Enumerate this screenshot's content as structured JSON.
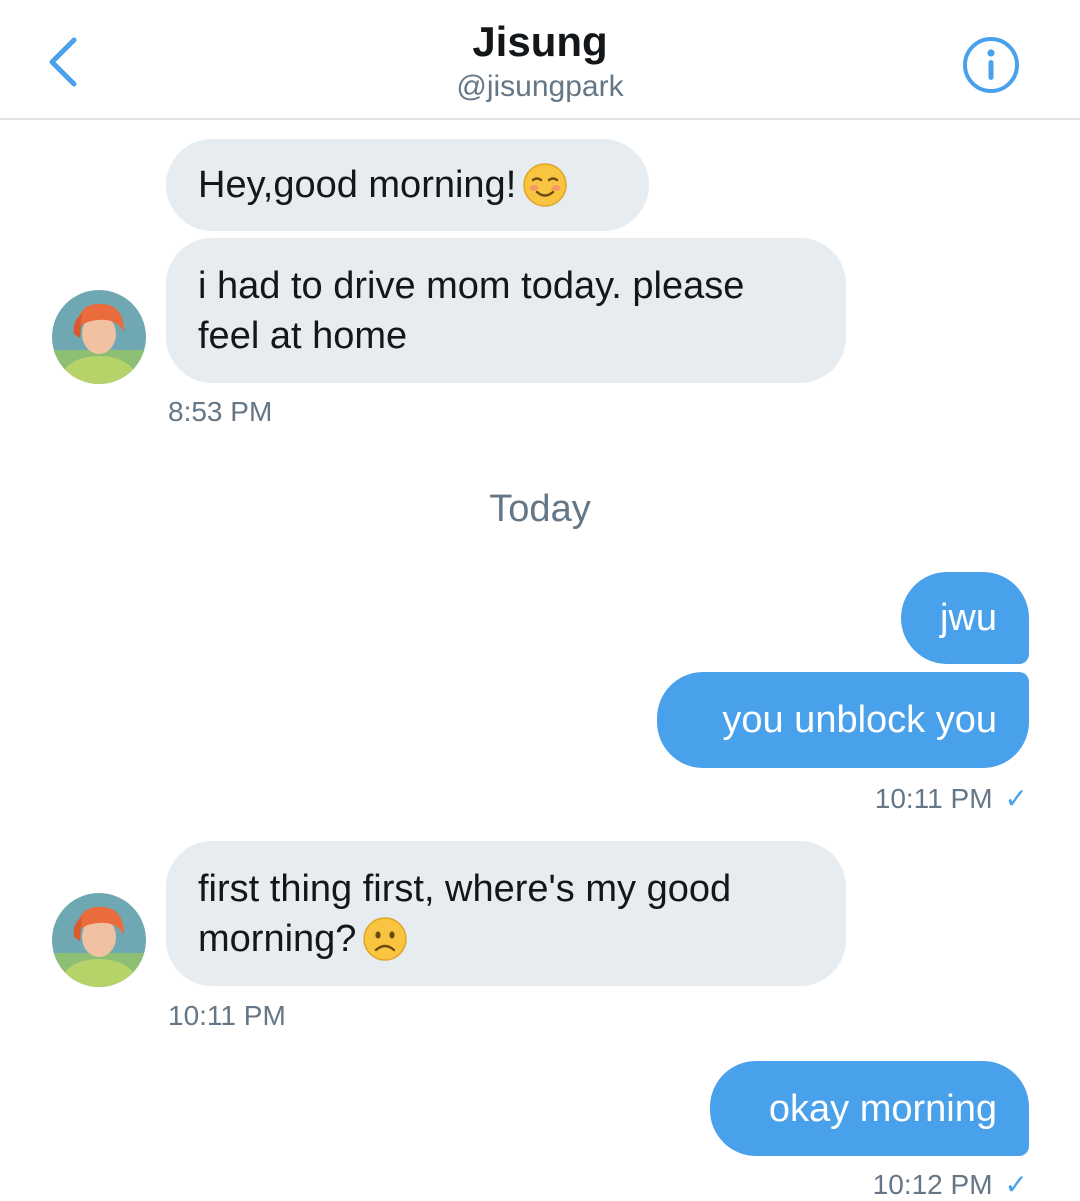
{
  "header": {
    "title": "Jisung",
    "handle": "@jisungpark",
    "back_icon": "chevron-left-icon",
    "info_icon": "info-icon"
  },
  "colors": {
    "accent": "#4aa1eb",
    "incoming_bubble": "#e6ecf0",
    "muted_text": "#657786"
  },
  "conversation": {
    "group1": {
      "msg1": "Hey,good morning!",
      "msg1_emoji": "smiling-face-with-blush-emoji",
      "msg2_line1": "i had to drive mom today. please",
      "msg2_line2": "feel at home",
      "time": "8:53 PM"
    },
    "day_separator": "Today",
    "group2": {
      "msg1": "jwu",
      "msg2": "you unblock you",
      "time": "10:11 PM",
      "status_icon": "checkmark-icon"
    },
    "group3": {
      "msg1_line1": "first thing first, where's my good",
      "msg1_line2": "morning?",
      "msg1_emoji": "frowning-face-emoji",
      "time": "10:11 PM"
    },
    "group4": {
      "msg1": "okay morning",
      "time": "10:12 PM",
      "status_icon": "checkmark-icon"
    },
    "check_glyph": "✓"
  }
}
